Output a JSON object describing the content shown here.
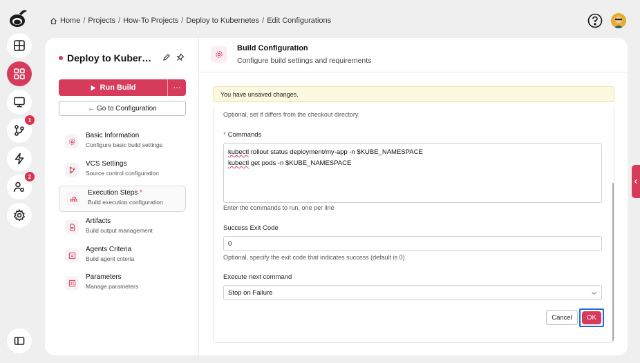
{
  "breadcrumb": {
    "items": [
      "Home",
      "Projects",
      "How-To Projects",
      "Deploy to Kubernetes",
      "Edit Configurations"
    ],
    "separator": "/"
  },
  "rail": {
    "badges": {
      "git": "1",
      "users": "2"
    }
  },
  "project": {
    "title": "Deploy to Kubernetes",
    "run_label": "Run Build",
    "more_label": "···",
    "goto_label": "← Go to Configuration"
  },
  "nav": [
    {
      "label": "Basic Information",
      "sub": "Configure basic build settings"
    },
    {
      "label": "VCS Settings",
      "sub": "Source control configuration"
    },
    {
      "label": "Execution Steps",
      "required": "*",
      "sub": "Build execution configuration"
    },
    {
      "label": "Artifacts",
      "sub": "Build output management"
    },
    {
      "label": "Agents Criteria",
      "sub": "Build agent criteria"
    },
    {
      "label": "Parameters",
      "sub": "Manage parameters"
    }
  ],
  "panel": {
    "title": "Build Configuration",
    "subtitle": "Configure build settings and requirements",
    "warning": "You have unsaved changes."
  },
  "form": {
    "workdir_hint": "Optional, set if differs from the checkout directory.",
    "commands_required": "*",
    "commands_label": "Commands",
    "commands": [
      {
        "first": "kubectl",
        "rest": " rollout status deployment/my-app -n $KUBE_NAMESPACE"
      },
      {
        "first": "kubectl",
        "rest": " get pods -n $KUBE_NAMESPACE"
      }
    ],
    "commands_hint": "Enter the commands to run, one per line",
    "exit_label": "Success Exit Code",
    "exit_value": "0",
    "exit_hint": "Optional, specify the exit code that indicates success (default is 0)",
    "next_label": "Execute next command",
    "next_value": "Stop on Failure",
    "cancel_label": "Cancel",
    "ok_label": "OK"
  },
  "colors": {
    "accent": "#d63b5c",
    "focus": "#1e6ad6",
    "warning_bg": "#fdf9e0"
  }
}
